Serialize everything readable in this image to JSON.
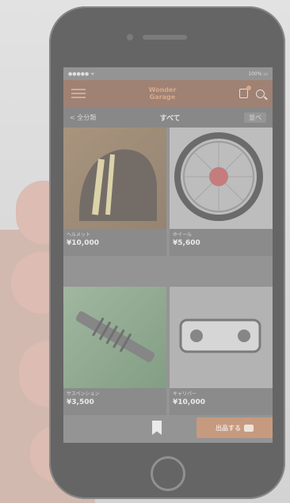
{
  "statusbar": {
    "carrier": "●●●●● ᯤ",
    "battery": "100% ▭"
  },
  "navbar": {
    "logo_line1": "Wonder",
    "logo_line2": "Garage"
  },
  "subbar": {
    "back_label": "< 全分類",
    "title": "すべて",
    "filter_label": "並べ"
  },
  "products": [
    {
      "name": "ヘルメット",
      "price": "¥10,000"
    },
    {
      "name": "ホイール",
      "price": "¥5,600"
    },
    {
      "name": "サスペンション",
      "price": "¥3,500"
    },
    {
      "name": "キャリパー",
      "price": "¥10,000"
    }
  ],
  "fab": {
    "label": "出品する"
  },
  "colors": {
    "accent": "#d5895c",
    "navbar": "#7b4f3a",
    "fab": "#b7734b"
  }
}
